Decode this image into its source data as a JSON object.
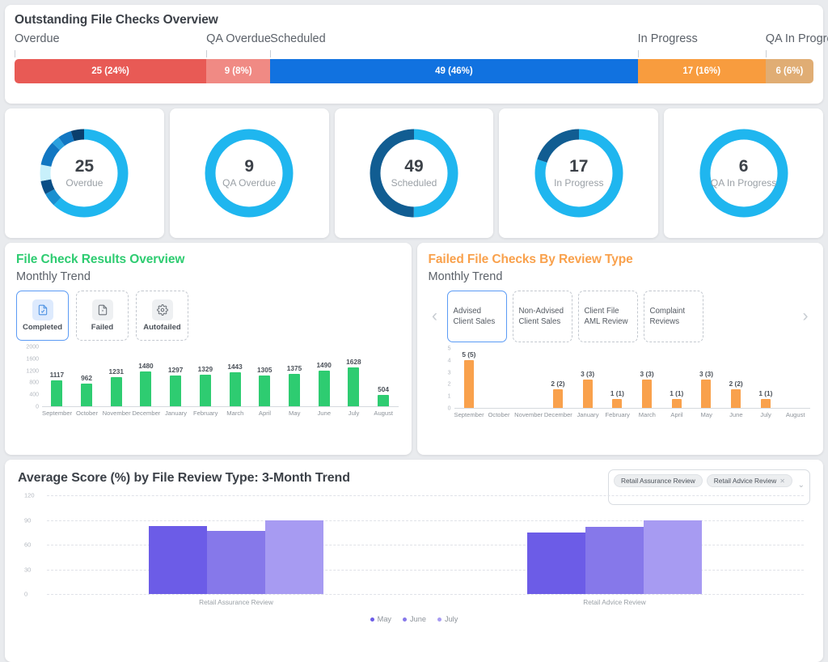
{
  "overview": {
    "title": "Outstanding File Checks Overview",
    "segments": [
      {
        "label": "Overdue",
        "value": 25,
        "pct": 24,
        "text": "25 (24%)",
        "color": "#e85a55"
      },
      {
        "label": "QA Overdue",
        "value": 9,
        "pct": 8,
        "text": "9 (8%)",
        "color": "#f08a84"
      },
      {
        "label": "Scheduled",
        "value": 49,
        "pct": 46,
        "text": "49 (46%)",
        "color": "#1172e0"
      },
      {
        "label": "In Progress",
        "value": 17,
        "pct": 16,
        "text": "17 (16%)",
        "color": "#f89c3e"
      },
      {
        "label": "QA In Progre..",
        "value": 6,
        "pct": 6,
        "text": "6 (6%)",
        "color": "#e0ad74"
      }
    ]
  },
  "donuts": [
    {
      "value": "25",
      "label": "Overdue",
      "segments": [
        {
          "color": "#1fb6ef",
          "pct": 62
        },
        {
          "color": "#1a8fd0",
          "pct": 5
        },
        {
          "color": "#0a4e86",
          "pct": 5
        },
        {
          "color": "#c8f0fb",
          "pct": 6
        },
        {
          "color": "#1277c2",
          "pct": 9
        },
        {
          "color": "#2aa0de",
          "pct": 3
        },
        {
          "color": "#1277c2",
          "pct": 5
        },
        {
          "color": "#0a3f6d",
          "pct": 5
        }
      ]
    },
    {
      "value": "9",
      "label": "QA Overdue",
      "segments": [
        {
          "color": "#1fb6ef",
          "pct": 100
        }
      ]
    },
    {
      "value": "49",
      "label": "Scheduled",
      "segments": [
        {
          "color": "#1fb6ef",
          "pct": 50
        },
        {
          "color": "#115d92",
          "pct": 50
        }
      ]
    },
    {
      "value": "17",
      "label": "In Progress",
      "segments": [
        {
          "color": "#1fb6ef",
          "pct": 80
        },
        {
          "color": "#115d92",
          "pct": 20
        }
      ]
    },
    {
      "value": "6",
      "label": "QA In Progress",
      "segments": [
        {
          "color": "#1fb6ef",
          "pct": 100
        }
      ]
    }
  ],
  "file_check_panel": {
    "title": "File Check Results Overview",
    "subtitle": "Monthly Trend",
    "tabs": [
      {
        "label": "Completed",
        "icon": "document-check-icon",
        "active": true
      },
      {
        "label": "Failed",
        "icon": "document-exclamation-icon",
        "active": false
      },
      {
        "label": "Autofailed",
        "icon": "gear-icon",
        "active": false
      }
    ]
  },
  "failed_panel": {
    "title": "Failed File Checks By Review Type",
    "subtitle": "Monthly Trend",
    "prev_arrow": "‹",
    "next_arrow": "›",
    "tabs": [
      {
        "label": "Advised Client Sales",
        "active": true
      },
      {
        "label": "Non-Advised Client Sales",
        "active": false
      },
      {
        "label": "Client File AML Review",
        "active": false
      },
      {
        "label": "Complaint Reviews",
        "active": false
      }
    ]
  },
  "bottom": {
    "title": "Average Score (%) by File Review Type: 3-Month Trend",
    "filter_chips": [
      {
        "label": "Retail Assurance Review",
        "removable": false,
        "x": ""
      },
      {
        "label": "Retail Advice Review",
        "removable": true,
        "x": "✕"
      }
    ],
    "caret": "⌄"
  },
  "chart_data": [
    {
      "type": "bar",
      "title": "File Check Results Overview",
      "subtitle": "Monthly Trend",
      "series_name": "Completed",
      "color": "#2ecc71",
      "categories": [
        "September",
        "October",
        "November",
        "December",
        "January",
        "February",
        "March",
        "April",
        "May",
        "June",
        "July",
        "August"
      ],
      "values": [
        1117,
        962,
        1231,
        1480,
        1297,
        1329,
        1443,
        1305,
        1375,
        1490,
        1628,
        504
      ],
      "labels": [
        "1117",
        "962",
        "1231",
        "1480",
        "1297",
        "1329",
        "1443",
        "1305",
        "1375",
        "1490",
        "1628",
        "504"
      ],
      "yticks": [
        0,
        400,
        800,
        1200,
        1600,
        2000
      ],
      "ylim": [
        0,
        2000
      ],
      "xlabel": "",
      "ylabel": "",
      "grid": false,
      "legend": "none"
    },
    {
      "type": "bar",
      "title": "Failed File Checks By Review Type",
      "subtitle": "Monthly Trend",
      "series_name": "Advised Client Sales",
      "color": "#f9a14c",
      "categories": [
        "September",
        "October",
        "November",
        "December",
        "January",
        "February",
        "March",
        "April",
        "May",
        "June",
        "July",
        "August"
      ],
      "values": [
        5,
        0,
        0,
        2,
        3,
        1,
        3,
        1,
        3,
        2,
        1,
        0
      ],
      "labels": [
        "5 (5)",
        "",
        "",
        "2 (2)",
        "3 (3)",
        "1 (1)",
        "3 (3)",
        "1 (1)",
        "3 (3)",
        "2 (2)",
        "1 (1)",
        ""
      ],
      "yticks": [
        0,
        1,
        2,
        3,
        4,
        5
      ],
      "ylim": [
        0,
        5
      ],
      "xlabel": "",
      "ylabel": "",
      "grid": false,
      "legend": "none"
    },
    {
      "type": "bar",
      "title": "Average Score (%) by File Review Type: 3-Month Trend",
      "categories": [
        "Retail Assurance Review",
        "Retail Advice Review"
      ],
      "series": [
        {
          "name": "May",
          "color": "#6c5ce7",
          "values": [
            83,
            75
          ]
        },
        {
          "name": "June",
          "color": "#8678ea",
          "values": [
            77,
            82
          ]
        },
        {
          "name": "July",
          "color": "#a79bf2",
          "values": [
            90,
            90
          ]
        }
      ],
      "yticks": [
        0,
        30,
        60,
        90,
        120
      ],
      "ylim": [
        0,
        120
      ],
      "xlabel": "",
      "ylabel": "",
      "grid": true,
      "legend": "bottom"
    }
  ]
}
